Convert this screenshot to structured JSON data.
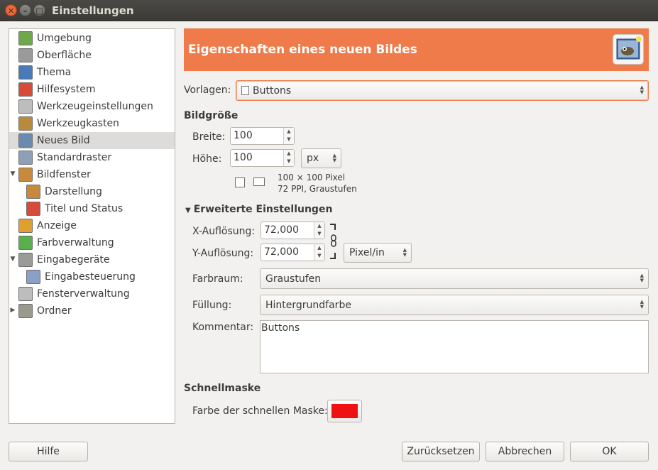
{
  "window": {
    "title": "Einstellungen"
  },
  "sidebar": {
    "items": [
      {
        "label": "Umgebung",
        "icon": "memory-chip-icon",
        "color": "#6fa84a"
      },
      {
        "label": "Oberfläche",
        "icon": "interface-icon",
        "color": "#9a9a9a"
      },
      {
        "label": "Thema",
        "icon": "theme-icon",
        "color": "#4a7ab8"
      },
      {
        "label": "Hilfesystem",
        "icon": "lifebuoy-icon",
        "color": "#d84a3a"
      },
      {
        "label": "Werkzeugeinstellungen",
        "icon": "tool-options-icon",
        "color": "#bdbdbd"
      },
      {
        "label": "Werkzeugkasten",
        "icon": "toolbox-icon",
        "color": "#b88a3a"
      },
      {
        "label": "Neues Bild",
        "icon": "new-image-icon",
        "color": "#6a8ab0"
      },
      {
        "label": "Standardraster",
        "icon": "grid-icon",
        "color": "#8ea0b8"
      },
      {
        "label": "Bildfenster",
        "icon": "image-window-icon",
        "color": "#c88a3a"
      },
      {
        "label": "Darstellung",
        "icon": "appearance-icon",
        "color": "#c88a3a"
      },
      {
        "label": "Titel und Status",
        "icon": "title-status-icon",
        "color": "#d84a3a"
      },
      {
        "label": "Anzeige",
        "icon": "display-icon",
        "color": "#e0a030"
      },
      {
        "label": "Farbverwaltung",
        "icon": "color-management-icon",
        "color": "#5ab04a"
      },
      {
        "label": "Eingabegeräte",
        "icon": "input-devices-icon",
        "color": "#9a9a9a"
      },
      {
        "label": "Eingabesteuerung",
        "icon": "input-controller-icon",
        "color": "#8aa0c8"
      },
      {
        "label": "Fensterverwaltung",
        "icon": "window-management-icon",
        "color": "#bdbdbd"
      },
      {
        "label": "Ordner",
        "icon": "folder-icon",
        "color": "#9a9a8a"
      }
    ],
    "selected": "Neues Bild"
  },
  "header": {
    "title": "Eigenschaften eines neuen Bildes",
    "accent": "#ef7b4a"
  },
  "vorlagen": {
    "label": "Vorlagen:",
    "value": "Buttons"
  },
  "bildgroesse": {
    "section": "Bildgröße",
    "width_label": "Breite:",
    "width_value": "100",
    "height_label": "Höhe:",
    "height_value": "100",
    "unit": "px",
    "info_line1": "100 × 100 Pixel",
    "info_line2": "72 PPI, Graustufen"
  },
  "advanced": {
    "section": "Erweiterte Einstellungen",
    "xres_label": "X-Auflösung:",
    "xres_value": "72,000",
    "yres_label": "Y-Auflösung:",
    "yres_value": "72,000",
    "res_unit": "Pixel/in",
    "colorspace_label": "Farbraum:",
    "colorspace_value": "Graustufen",
    "fill_label": "Füllung:",
    "fill_value": "Hintergrundfarbe",
    "comment_label": "Kommentar:",
    "comment_value": "Buttons"
  },
  "quickmask": {
    "section": "Schnellmaske",
    "label": "Farbe der schnellen Maske:",
    "color": "#f01212"
  },
  "buttons": {
    "help": "Hilfe",
    "reset": "Zurücksetzen",
    "cancel": "Abbrechen",
    "ok": "OK"
  }
}
